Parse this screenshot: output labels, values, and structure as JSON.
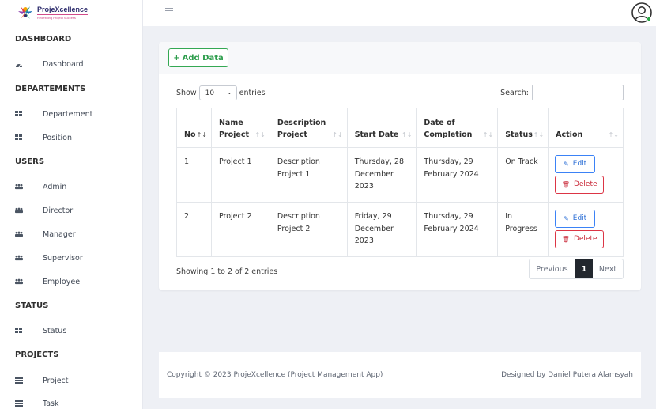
{
  "brand": {
    "name": "ProjeXcellence",
    "tagline": "Redefining Project Success"
  },
  "sidebar": {
    "sections": [
      {
        "heading": "DASHBOARD",
        "items": [
          {
            "label": "Dashboard",
            "icon": "gauge-icon"
          }
        ]
      },
      {
        "heading": "DEPARTEMENTS",
        "items": [
          {
            "label": "Departement",
            "icon": "grid-icon"
          },
          {
            "label": "Position",
            "icon": "grid-icon"
          }
        ]
      },
      {
        "heading": "USERS",
        "items": [
          {
            "label": "Admin",
            "icon": "users-icon"
          },
          {
            "label": "Director",
            "icon": "users-icon"
          },
          {
            "label": "Manager",
            "icon": "users-icon"
          },
          {
            "label": "Supervisor",
            "icon": "users-icon"
          },
          {
            "label": "Employee",
            "icon": "users-icon"
          }
        ]
      },
      {
        "heading": "STATUS",
        "items": [
          {
            "label": "Status",
            "icon": "grid-icon"
          }
        ]
      },
      {
        "heading": "PROJECTS",
        "items": [
          {
            "label": "Project",
            "icon": "list-icon"
          },
          {
            "label": "Task",
            "icon": "list-icon"
          }
        ]
      }
    ]
  },
  "toolbar": {
    "add_label": "Add Data"
  },
  "table_controls": {
    "show_label": "Show",
    "entries_value": "10",
    "entries_label": "entries",
    "search_label": "Search:"
  },
  "table": {
    "headers": [
      "No",
      "Name Project",
      "Description Project",
      "Start Date",
      "Date of Completion",
      "Status",
      "Action"
    ],
    "rows": [
      {
        "no": "1",
        "name": "Project 1",
        "description": "Description Project 1",
        "start": "Thursday, 28 December 2023",
        "completion": "Thursday, 29 February 2024",
        "status": "On Track"
      },
      {
        "no": "2",
        "name": "Project 2",
        "description": "Description Project 2",
        "start": "Friday, 29 December 2023",
        "completion": "Thursday, 29 February 2024",
        "status": "In Progress"
      }
    ],
    "edit_label": "Edit",
    "delete_label": "Delete"
  },
  "pagination": {
    "showing": "Showing 1 to 2 of 2 entries",
    "previous": "Previous",
    "current": "1",
    "next": "Next"
  },
  "footer": {
    "copyright": "Copyright © 2023 ProjeXcellence (Project Management App)",
    "credit": "Designed by Daniel Putera Alamsyah"
  },
  "colors": {
    "accent_green": "#34a853",
    "edit_blue": "#3b82f6",
    "delete_red": "#dc3545",
    "active_page": "#22272e",
    "background": "#eef0f5"
  }
}
